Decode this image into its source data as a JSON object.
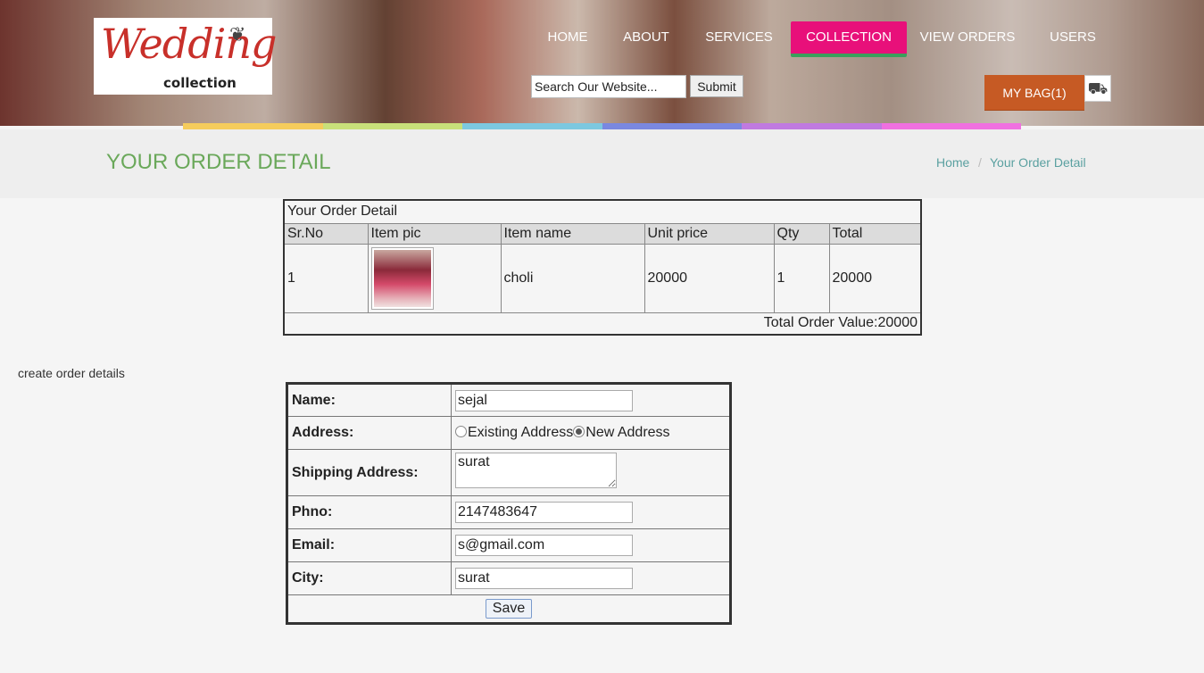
{
  "header": {
    "logo": {
      "script": "Wedding",
      "sub": "collection"
    },
    "nav": [
      {
        "label": "HOME"
      },
      {
        "label": "ABOUT"
      },
      {
        "label": "SERVICES"
      },
      {
        "label": "COLLECTION",
        "active": true
      },
      {
        "label": "VIEW ORDERS"
      },
      {
        "label": "USERS"
      }
    ],
    "search": {
      "placeholder": "Search Our Website...",
      "value": "Search Our Website..."
    },
    "submit_label": "Submit",
    "bag_label": "MY BAG(1)",
    "rainbow_colors": [
      "#f5cc5c",
      "#c8e07a",
      "#7cc8e0",
      "#7a88e0",
      "#c07ae0",
      "#f070e0"
    ],
    "active_color": "#e8107a",
    "bag_color": "#c65a24"
  },
  "page": {
    "title": "YOUR ORDER DETAIL",
    "breadcrumb": [
      {
        "label": "Home"
      },
      {
        "label": "Your Order Detail"
      }
    ],
    "title_color": "#6aa85a"
  },
  "order": {
    "caption": "Your Order Detail",
    "columns": [
      "Sr.No",
      "Item pic",
      "Item name",
      "Unit price",
      "Qty",
      "Total"
    ],
    "rows": [
      {
        "sr": "1",
        "name": "choli",
        "unit_price": "20000",
        "qty": "1",
        "total": "20000"
      }
    ],
    "total_label": "Total Order Value:20000"
  },
  "create_label": "create order details",
  "form": {
    "name_label": "Name:",
    "name_value": "sejal",
    "address_label": "Address:",
    "address_options": [
      {
        "label": "Existing Address",
        "selected": false
      },
      {
        "label": "New Address",
        "selected": true
      }
    ],
    "shipping_label": "Shipping Address:",
    "shipping_value": "surat",
    "phno_label": "Phno:",
    "phno_value": "2147483647",
    "email_label": "Email:",
    "email_value": "s@gmail.com",
    "city_label": "City:",
    "city_value": "surat",
    "save_label": "Save"
  }
}
